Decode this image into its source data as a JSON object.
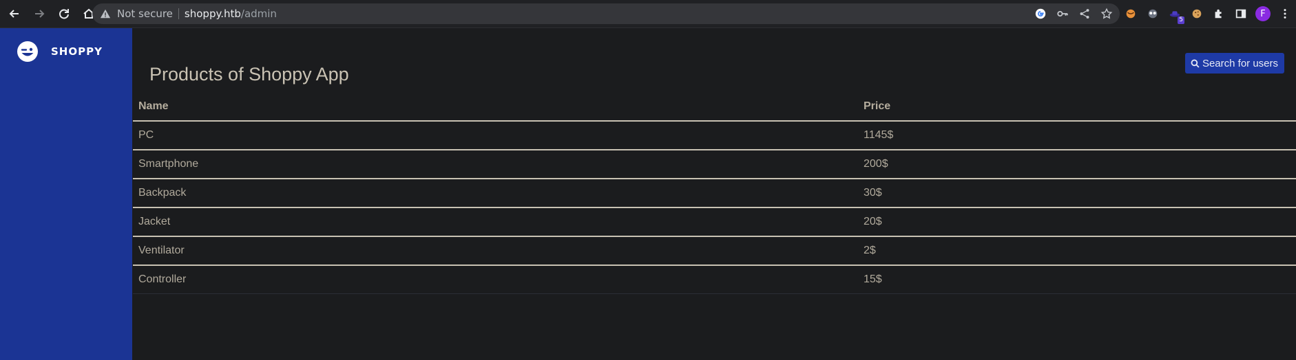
{
  "browser": {
    "security_label": "Not secure",
    "url_host": "shoppy.htb",
    "url_path": "/admin",
    "extension_badge": "5",
    "profile_initial": "F",
    "icons": [
      "back-icon",
      "forward-icon",
      "reload-icon",
      "home-icon",
      "warning-icon",
      "google-icon",
      "key-icon",
      "share-icon",
      "star-icon",
      "extension-icon",
      "puzzle-icon",
      "sidepanel-icon",
      "menu-icon"
    ]
  },
  "sidebar": {
    "brand": "SHOPPY"
  },
  "main": {
    "title": "Products of Shoppy App",
    "search_button": "Search for users"
  },
  "table": {
    "headers": [
      "Name",
      "Price"
    ],
    "rows": [
      {
        "name": "PC",
        "price": "1145$"
      },
      {
        "name": "Smartphone",
        "price": "200$"
      },
      {
        "name": "Backpack",
        "price": "30$"
      },
      {
        "name": "Jacket",
        "price": "20$"
      },
      {
        "name": "Ventilator",
        "price": "2$"
      },
      {
        "name": "Controller",
        "price": "15$"
      }
    ]
  },
  "colors": {
    "sidebar": "#1b3494",
    "background": "#1b1c1e",
    "button": "#1e3aa6",
    "text": "#b1aa9c"
  }
}
